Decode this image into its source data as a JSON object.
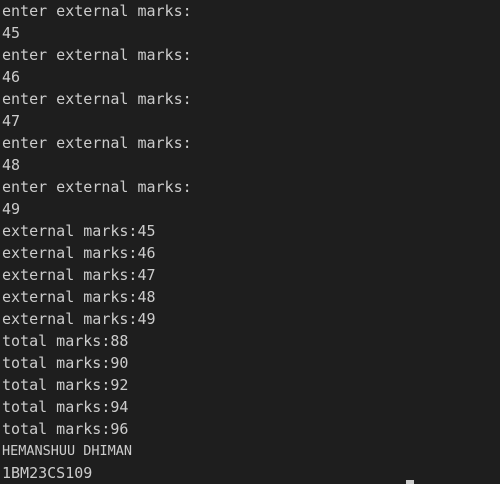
{
  "terminal": {
    "lines": [
      "enter external marks:",
      "45",
      "enter external marks:",
      "46",
      "enter external marks:",
      "47",
      "enter external marks:",
      "48",
      "enter external marks:",
      "49",
      "external marks:45",
      "external marks:46",
      "external marks:47",
      "external marks:48",
      "external marks:49",
      "total marks:88",
      "total marks:90",
      "total marks:92",
      "total marks:94",
      "total marks:96",
      "HEMANSHUU DHIMAN",
      "1BM23CS109"
    ]
  }
}
